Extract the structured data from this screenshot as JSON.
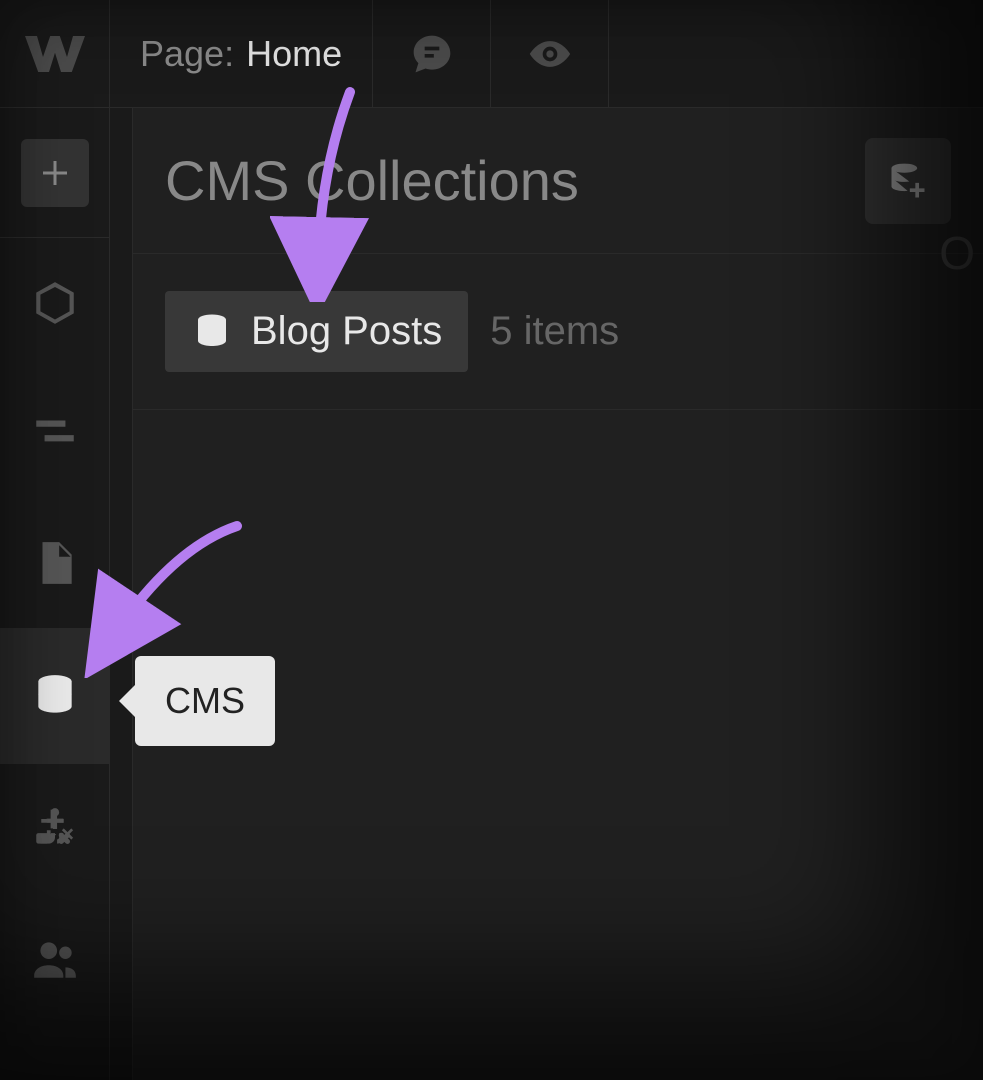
{
  "topbar": {
    "page_label": "Page:",
    "page_name": "Home"
  },
  "panel": {
    "title": "CMS Collections"
  },
  "collections": [
    {
      "name": "Blog Posts",
      "count_label": "5 items"
    }
  ],
  "sidebar": {
    "tooltip_cms": "CMS"
  }
}
